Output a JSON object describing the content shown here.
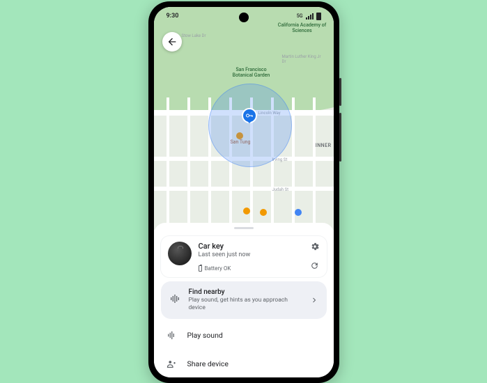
{
  "status": {
    "time": "9:30",
    "network": "5G"
  },
  "map": {
    "park_label_main": "San Francisco Botanical Garden",
    "park_label_top": "California Academy of Sciences",
    "district": "INNER",
    "poi1": "San Tung",
    "streets": {
      "irving": "Irving St",
      "judah": "Judah St",
      "lincoln": "Lincoln Way",
      "stow": "Stow Lake Dr",
      "mlk": "Martin Luther King Jr Dr"
    }
  },
  "device": {
    "name": "Car key",
    "last_seen": "Last seen just now",
    "battery": "Battery OK"
  },
  "find": {
    "title": "Find nearby",
    "subtitle": "Play sound, get hints as you approach device"
  },
  "actions": {
    "play_sound": "Play sound",
    "share": "Share device"
  }
}
